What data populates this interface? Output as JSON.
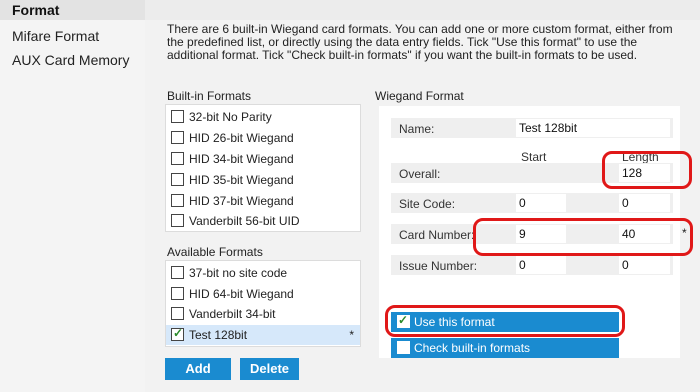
{
  "sidebar": {
    "header": "Format",
    "items": [
      {
        "label": "Mifare Format"
      },
      {
        "label": "AUX Card Memory"
      }
    ]
  },
  "intro_text": "There are 6 built-in Wiegand card formats. You can add one or more custom format, either from the predefined list, or directly using the data entry fields. Tick \"Use this format\" to use the additional format. Tick \"Check built-in formats\" if you want the built-in formats to be used.",
  "builtin": {
    "title": "Built-in Formats",
    "items": [
      {
        "label": "32-bit No Parity",
        "checked": false
      },
      {
        "label": "HID 26-bit Wiegand",
        "checked": false
      },
      {
        "label": "HID 34-bit Wiegand",
        "checked": false
      },
      {
        "label": "HID 35-bit Wiegand",
        "checked": false
      },
      {
        "label": "HID 37-bit Wiegand",
        "checked": false
      },
      {
        "label": "Vanderbilt 56-bit UID",
        "checked": false
      }
    ]
  },
  "available": {
    "title": "Available Formats",
    "items": [
      {
        "label": "37-bit no site code",
        "checked": false
      },
      {
        "label": "HID 64-bit Wiegand",
        "checked": false
      },
      {
        "label": "Vanderbilt 34-bit",
        "checked": false
      },
      {
        "label": "Test 128bit",
        "checked": true,
        "selected": true,
        "marker": "*"
      }
    ]
  },
  "buttons": {
    "add": "Add",
    "delete": "Delete"
  },
  "wiegand": {
    "title": "Wiegand Format",
    "name_label": "Name:",
    "name_value": "Test 128bit",
    "col_start": "Start",
    "col_length": "Length",
    "overall_label": "Overall:",
    "overall_length": "128",
    "site_label": "Site Code:",
    "site_start": "0",
    "site_length": "0",
    "card_label": "Card Number:",
    "card_start": "9",
    "card_length": "40",
    "card_marker": "*",
    "issue_label": "Issue Number:",
    "issue_start": "0",
    "issue_length": "0",
    "use_format_label": "Use this format",
    "use_format_checked": true,
    "check_builtin_label": "Check built-in formats",
    "check_builtin_checked": false
  },
  "colors": {
    "accent": "#1a8bd0",
    "highlight_ring": "#e01818",
    "selected_row": "#d6e8fa"
  }
}
